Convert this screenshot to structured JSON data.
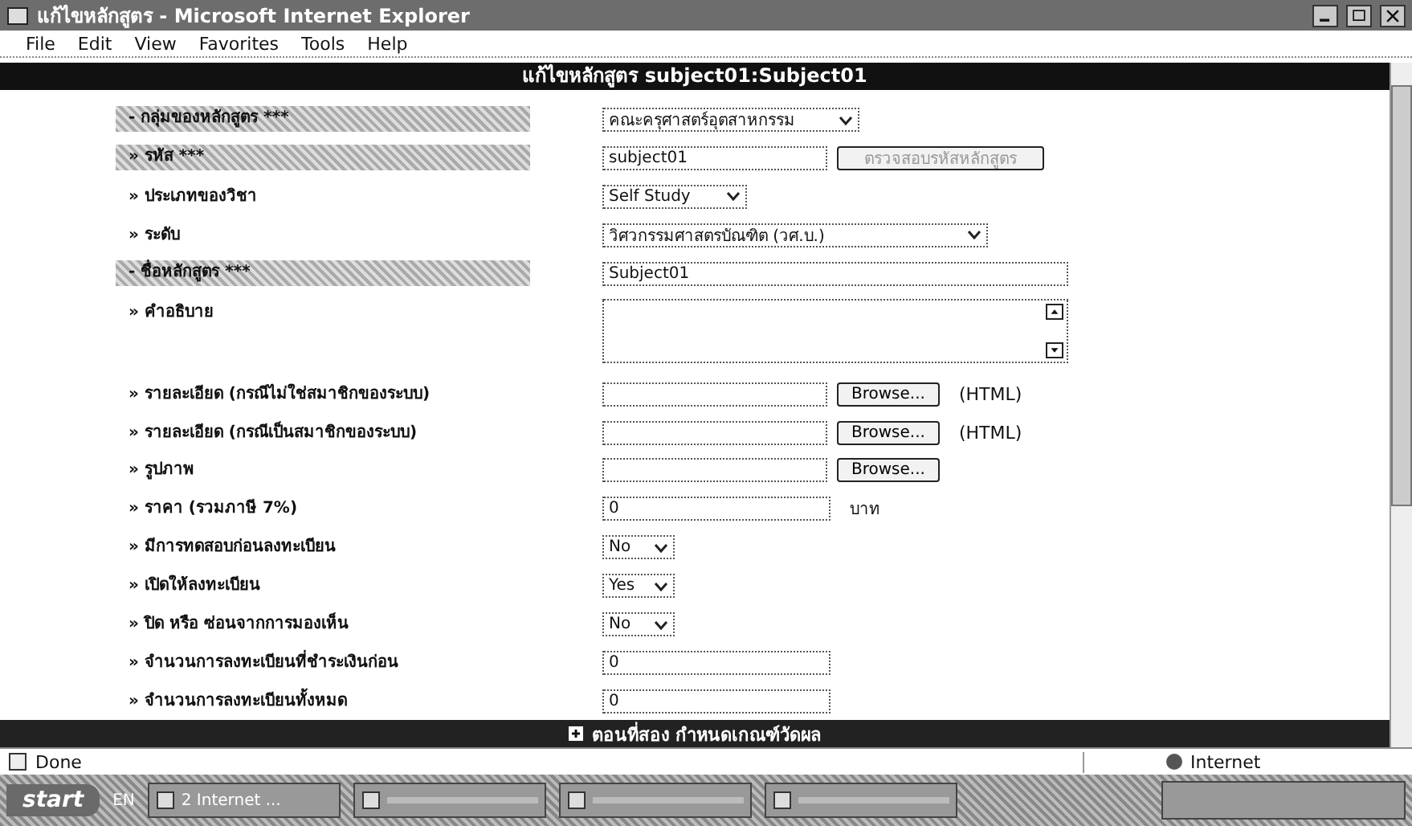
{
  "window": {
    "title": "แก้ไขหลักสูตร - Microsoft Internet Explorer"
  },
  "menu": [
    "File",
    "Edit",
    "View",
    "Favorites",
    "Tools",
    "Help"
  ],
  "page_header": "แก้ไขหลักสูตร subject01:Subject01",
  "rows": [
    {
      "kind": "section",
      "label": "- กลุ่มของหลักสูตร ***",
      "field": {
        "kind": "select",
        "value": "คณะครุศาสตร์อุตสาหกรรม"
      }
    },
    {
      "kind": "section",
      "label": "» รหัส ***",
      "field": {
        "kind": "input_button",
        "value": "subject01",
        "button": {
          "label": "ตรวจสอบรหัสหลักสูตร",
          "disabled": true
        }
      }
    },
    {
      "kind": "label",
      "label": "» ประเภทของวิชา",
      "field": {
        "kind": "select",
        "value": "Self Study"
      }
    },
    {
      "kind": "label",
      "label": "» ระดับ",
      "field": {
        "kind": "select_wide",
        "value": "วิศวกรรมศาสตรบัณฑิต (วศ.บ.)"
      }
    },
    {
      "kind": "section",
      "label": "- ชื่อหลักสูตร ***",
      "field": {
        "kind": "input_wide",
        "value": "Subject01"
      }
    },
    {
      "kind": "label",
      "label": "» คำอธิบาย",
      "field": {
        "kind": "textarea"
      }
    },
    {
      "kind": "label",
      "label": "» รายละเอียด (กรณีไม่ใช่สมาชิกของระบบ)",
      "field": {
        "kind": "file",
        "button": "Browse...",
        "note": "(HTML)"
      }
    },
    {
      "kind": "label",
      "label": "» รายละเอียด (กรณีเป็นสมาชิกของระบบ)",
      "field": {
        "kind": "file",
        "button": "Browse...",
        "note": "(HTML)"
      }
    },
    {
      "kind": "label",
      "label": "» รูปภาพ",
      "field": {
        "kind": "file",
        "button": "Browse..."
      }
    },
    {
      "kind": "label",
      "label": "» ราคา (รวมภาษี 7%)",
      "field": {
        "kind": "input",
        "value": "0",
        "unit": "บาท"
      }
    },
    {
      "kind": "label",
      "label": "» มีการทดสอบก่อนลงทะเบียน",
      "field": {
        "kind": "select_small",
        "value": "No"
      }
    },
    {
      "kind": "label",
      "label": "» เปิดให้ลงทะเบียน",
      "field": {
        "kind": "select_small",
        "value": "Yes"
      }
    },
    {
      "kind": "label",
      "label": "» ปิด หรือ ซ่อนจากการมองเห็น",
      "field": {
        "kind": "select_small",
        "value": "No"
      }
    },
    {
      "kind": "label",
      "label": "» จำนวนการลงทะเบียนที่ชำระเงินก่อน",
      "field": {
        "kind": "input",
        "value": "0"
      }
    },
    {
      "kind": "label",
      "label": "» จำนวนการลงทะเบียนทั้งหมด",
      "field": {
        "kind": "input",
        "value": "0"
      }
    }
  ],
  "next_section": {
    "label": "ตอนที่สอง กำหนดเกณฑ์วัดผล",
    "expanded": false
  },
  "status_bar": {
    "text": "Done",
    "zone": "Internet"
  },
  "taskbar": {
    "start": "start",
    "language": "EN",
    "tasks": [
      {
        "kind": "labeled",
        "label": "2 Internet ..."
      },
      {
        "kind": "blurred"
      },
      {
        "kind": "blurred"
      },
      {
        "kind": "blurred"
      }
    ]
  }
}
